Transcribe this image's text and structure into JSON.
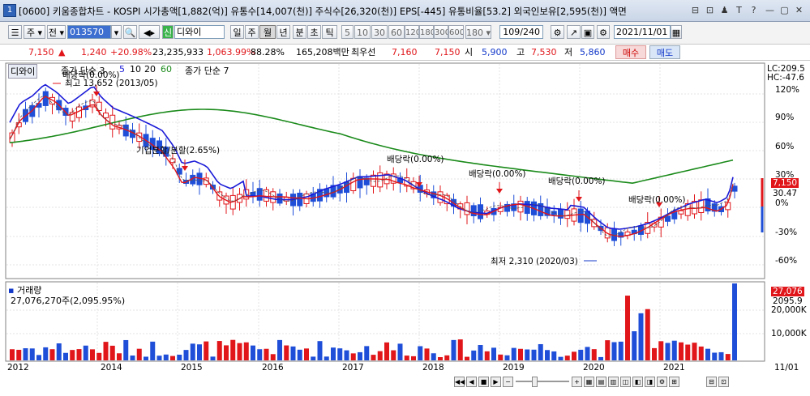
{
  "window": {
    "title": "[0600] 키움종합차트 - KOSPI 시가총액[1,882(억)] 유통수[14,007(천)] 주식수[26,320(천)] EPS[-445] 유통비율[53.2] 외국인보유[2,595(천)] 액면",
    "app_number": "1",
    "controls": [
      "⊟",
      "⊡",
      "♟",
      "T",
      "?",
      "—",
      "▢",
      "✕"
    ]
  },
  "toolbar": {
    "code_value": "013570",
    "type_main": "주",
    "type_prev": "전",
    "stock_name": "디와이",
    "stock_prefix": "신",
    "periods": [
      "일",
      "주",
      "월",
      "년",
      "분",
      "초",
      "틱"
    ],
    "selected_period": "월",
    "minutes": [
      "5",
      "10",
      "30",
      "60",
      "120",
      "180",
      "300",
      "600",
      "180"
    ],
    "count": "109/240",
    "date": "2021/11/01"
  },
  "quote": {
    "price": "7,150",
    "arrow": "▲",
    "change": "1,240",
    "rate": "+20.98%",
    "volume": "23,235,933",
    "vol_ratio": "1,063.99%",
    "vol_rate2": "88.28%",
    "amount": "165,208백만",
    "label_best": "최우선",
    "ask": "7,160",
    "bid": "7,150",
    "label_open": "시",
    "open": "5,900",
    "label_high": "고",
    "high": "7,530",
    "label_low": "저",
    "low": "5,860",
    "buy_label": "매수",
    "sell_label": "매도"
  },
  "price_panel": {
    "stock_tag": "디와이",
    "ma_legend": "종가 단순 3",
    "ma_values": [
      "5",
      "10",
      "20",
      "60"
    ],
    "ma_legend2": "종가 단순 7",
    "max_label": "최고 13,652 (2013/05)",
    "min_label": "최저 2,310 (2020/03)",
    "annotations": [
      "배당락(0.00%)",
      "기업분할/분할(2.65%)",
      "배당락(0.00%)",
      "배당락(0.00%)",
      "배당락(0.00%)",
      "배당락(0.00%)"
    ],
    "lc_label": "LC:209.5",
    "hc_label": "HC:-47.6",
    "right_axis": [
      "120%",
      "90%",
      "60%",
      "30%",
      "0%",
      "-30%",
      "-60%"
    ],
    "current_price_tag": "7,150",
    "current_pct_tag": "30.47"
  },
  "volume_panel": {
    "title": "거래량",
    "value": "27,076,270주(2,095.95%)",
    "right_axis": [
      "20,000K",
      "10,000K"
    ],
    "current_tag": "27,076",
    "current_pct": "2095.9"
  },
  "x_axis": [
    "2012",
    "2014",
    "2015",
    "2016",
    "2017",
    "2018",
    "2019",
    "2020",
    "2021",
    "11/01"
  ],
  "colors": {
    "up": "#e0161a",
    "down": "#1f4fd8",
    "ma_green": "#1a8a1a",
    "ma_blue": "#1a1ad8",
    "ma_red": "#e0161a"
  }
}
